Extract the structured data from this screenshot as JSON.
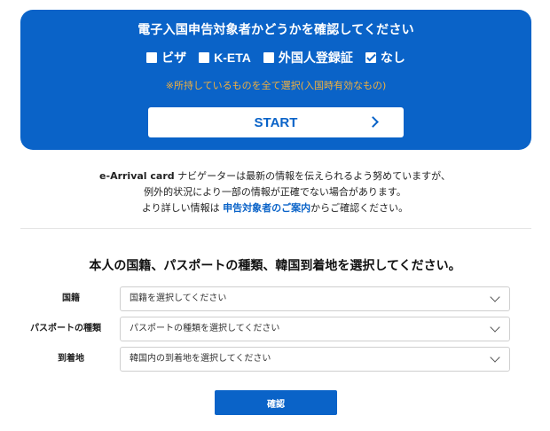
{
  "eligibility_panel": {
    "title": "電子入国申告対象者かどうかを確認してください",
    "options": [
      {
        "label": "ビザ",
        "checked": false
      },
      {
        "label": "K-ETA",
        "checked": false
      },
      {
        "label": "外国人登録証",
        "checked": false
      },
      {
        "label": "なし",
        "checked": true
      }
    ],
    "notice": "※所持しているものを全て選択(入国時有効なもの)",
    "start_label": "START"
  },
  "info": {
    "line1_bold": "e-Arrival card",
    "line1_rest": " ナビゲーターは最新の情報を伝えられるよう努めていますが、",
    "line2": "例外的状況により一部の情報が正確でない場合があります。",
    "line3_pre": "より詳しい情報は ",
    "line3_link": "申告対象者のご案内",
    "line3_post": "からご確認ください。"
  },
  "form": {
    "heading": "本人の国籍、パスポートの種類、韓国到着地を選択してください。",
    "fields": [
      {
        "label": "国籍",
        "placeholder": "国籍を選択してください"
      },
      {
        "label": "パスポートの種類",
        "placeholder": "パスポートの種類を選択してください"
      },
      {
        "label": "到着地",
        "placeholder": "韓国内の到着地を選択してください"
      }
    ],
    "confirm_label": "確認"
  },
  "colors": {
    "brand_blue": "#0a63c8",
    "notice_orange": "#f3b03d"
  },
  "icons": {
    "start": "chevron-right-icon",
    "select": "chevron-down-icon",
    "check": "checkmark-icon"
  }
}
